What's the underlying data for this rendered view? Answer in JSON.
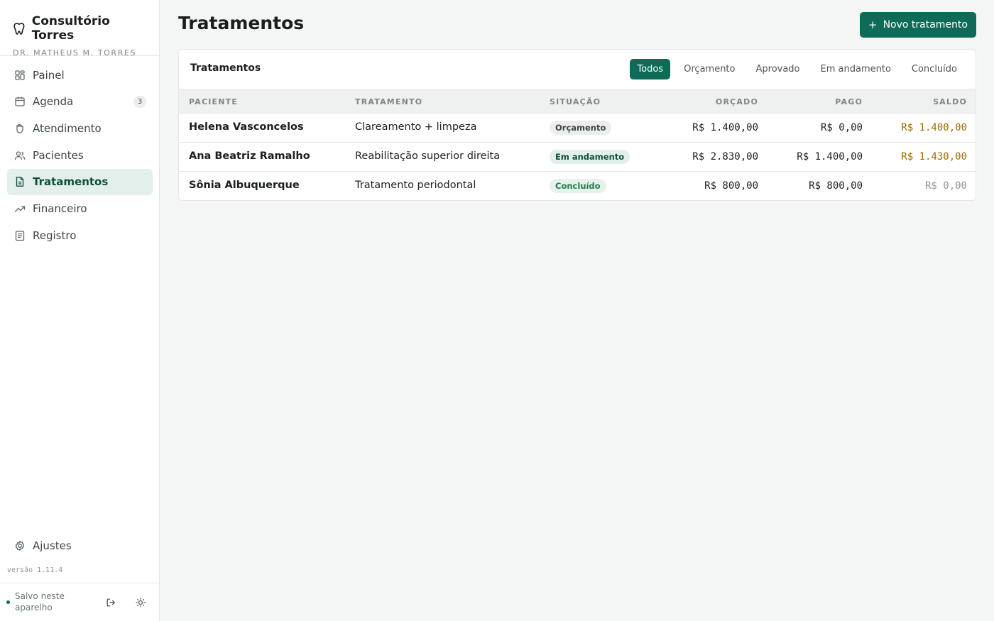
{
  "app": {
    "name": "Consultório Torres",
    "doctor": "DR. MATHEUS M. TORRES",
    "version": "versão 1.11.4",
    "saved_status": "Salvo neste aparelho"
  },
  "sidebar": {
    "items": [
      {
        "label": "Painel",
        "icon": "dashboard-icon"
      },
      {
        "label": "Agenda",
        "icon": "calendar-icon",
        "badge": "3"
      },
      {
        "label": "Atendimento",
        "icon": "hand-icon"
      },
      {
        "label": "Pacientes",
        "icon": "users-icon"
      },
      {
        "label": "Tratamentos",
        "icon": "document-icon",
        "active": true
      },
      {
        "label": "Financeiro",
        "icon": "trending-up-icon"
      },
      {
        "label": "Registro",
        "icon": "list-icon"
      }
    ],
    "settings_label": "Ajustes"
  },
  "header": {
    "title": "Tratamentos",
    "new_button": "Novo tratamento"
  },
  "card": {
    "title": "Tratamentos",
    "filters": [
      "Todos",
      "Orçamento",
      "Aprovado",
      "Em andamento",
      "Concluído"
    ],
    "active_filter": "Todos",
    "columns": [
      "PACIENTE",
      "TRATAMENTO",
      "SITUAÇÃO",
      "ORÇADO",
      "PAGO",
      "SALDO"
    ],
    "rows": [
      {
        "patient": "Helena Vasconcelos",
        "treatment": "Clareamento + limpeza",
        "status": "Orçamento",
        "budget": "R$ 1.400,00",
        "paid": "R$ 0,00",
        "balance": "R$ 1.400,00"
      },
      {
        "patient": "Ana Beatriz Ramalho",
        "treatment": "Reabilitação superior direita",
        "status": "Em andamento",
        "budget": "R$ 2.830,00",
        "paid": "R$ 1.400,00",
        "balance": "R$ 1.430,00"
      },
      {
        "patient": "Sônia Albuquerque",
        "treatment": "Tratamento periodontal",
        "status": "Concluído",
        "budget": "R$ 800,00",
        "paid": "R$ 800,00",
        "balance": "R$ 0,00"
      }
    ]
  },
  "colors": {
    "primary": "#0e6b57",
    "active_bg": "#e2efea",
    "balance_due": "#a06a00",
    "balance_zero": "#8d9693",
    "status_orcamento_bg": "#eceeed",
    "status_andamento_bg": "#e2efea",
    "status_concluido_bg": "#e6f1ea"
  }
}
